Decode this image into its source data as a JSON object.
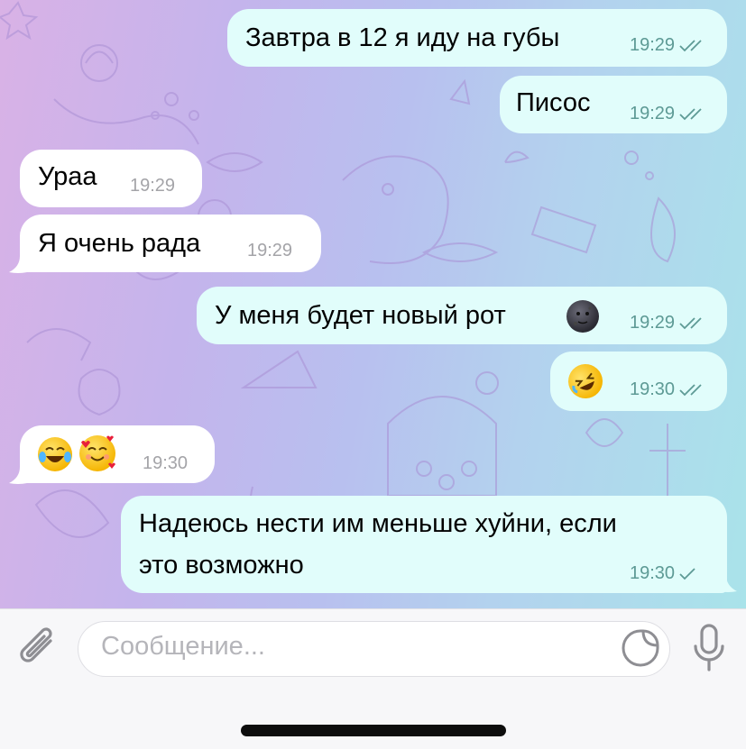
{
  "chat": {
    "messages": [
      {
        "direction": "outgoing",
        "text": "Завтра в 12 я иду на губы",
        "time": "19:29",
        "status": "read"
      },
      {
        "direction": "outgoing",
        "text": "Писос",
        "time": "19:29",
        "status": "read"
      },
      {
        "direction": "incoming",
        "text": "Ураа",
        "time": "19:29"
      },
      {
        "direction": "incoming",
        "text": "Я очень рада",
        "time": "19:29"
      },
      {
        "direction": "outgoing",
        "text": "У меня будет новый рот",
        "emoji": "new-moon-face-emoji",
        "time": "19:29",
        "status": "read"
      },
      {
        "direction": "outgoing",
        "emoji": "rolling-on-floor-laughing-emoji",
        "time": "19:30",
        "status": "read"
      },
      {
        "direction": "incoming",
        "emoji": [
          "tears-of-joy-emoji",
          "smiling-face-with-hearts-emoji"
        ],
        "time": "19:30"
      },
      {
        "direction": "outgoing",
        "text_line1": "Надеюсь нести им меньше хуйни, если",
        "text_line2": "это возможно",
        "time": "19:30",
        "status": "sent"
      }
    ]
  },
  "composer": {
    "placeholder": "Сообщение...",
    "icons": [
      "paperclip-icon",
      "sticker-icon",
      "microphone-icon"
    ]
  },
  "colors": {
    "outgoing_bubble": "#e1fdfb",
    "incoming_bubble": "#ffffff",
    "outgoing_meta": "#5d9a95",
    "incoming_meta": "#a4a4a8",
    "placeholder": "#b5b5ba"
  }
}
